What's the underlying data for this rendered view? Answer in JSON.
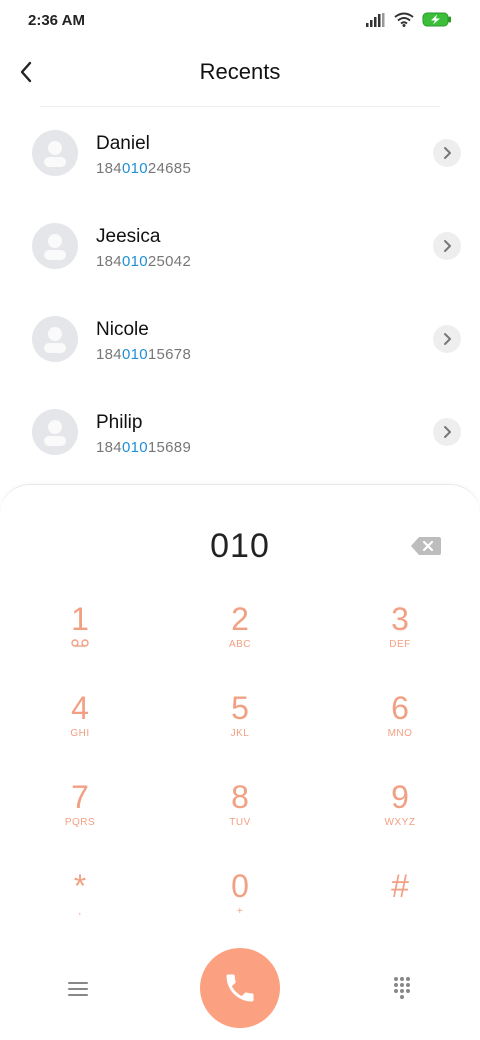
{
  "status_bar": {
    "time": "2:36 AM",
    "icons": [
      "signal-icon",
      "wifi-icon",
      "battery-charging-icon"
    ]
  },
  "header": {
    "title": "Recents",
    "back_icon": "back-arrow-icon"
  },
  "recents": [
    {
      "name": "Daniel",
      "number_prefix": "184",
      "number_match": "010",
      "number_suffix": "24685"
    },
    {
      "name": "Jeesica",
      "number_prefix": "184",
      "number_match": "010",
      "number_suffix": "25042"
    },
    {
      "name": "Nicole",
      "number_prefix": "184",
      "number_match": "010",
      "number_suffix": "15678"
    },
    {
      "name": "Philip",
      "number_prefix": "184",
      "number_match": "010",
      "number_suffix": "15689"
    }
  ],
  "dialpad": {
    "input_value": "010",
    "keys": [
      {
        "digit": "1",
        "letters": "voicemail-icon"
      },
      {
        "digit": "2",
        "letters": "ABC"
      },
      {
        "digit": "3",
        "letters": "DEF"
      },
      {
        "digit": "4",
        "letters": "GHI"
      },
      {
        "digit": "5",
        "letters": "JKL"
      },
      {
        "digit": "6",
        "letters": "MNO"
      },
      {
        "digit": "7",
        "letters": "PQRS"
      },
      {
        "digit": "8",
        "letters": "TUV"
      },
      {
        "digit": "9",
        "letters": "WXYZ"
      },
      {
        "digit": "*",
        "letters": ","
      },
      {
        "digit": "0",
        "letters": "+"
      },
      {
        "digit": "#",
        "letters": ""
      }
    ]
  },
  "bottom_bar": {
    "menu_icon": "hamburger-menu-icon",
    "call_icon": "phone-icon",
    "grid_icon": "dialpad-grid-icon"
  },
  "colors": {
    "accent": "#fba181",
    "key_text": "#f2a084",
    "match_highlight": "#1f8fd6"
  }
}
